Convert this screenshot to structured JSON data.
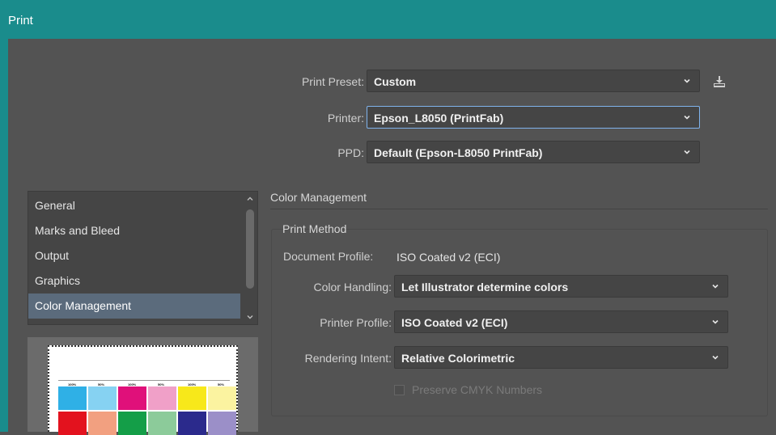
{
  "window": {
    "title": "Print"
  },
  "top": {
    "preset": {
      "label": "Print Preset:",
      "value": "Custom"
    },
    "printer": {
      "label": "Printer:",
      "value": "Epson_L8050 (PrintFab)"
    },
    "ppd": {
      "label": "PPD:",
      "value": "Default (Epson-L8050 PrintFab)"
    }
  },
  "sidebar": {
    "items": [
      {
        "label": "General"
      },
      {
        "label": "Marks and Bleed"
      },
      {
        "label": "Output"
      },
      {
        "label": "Graphics"
      },
      {
        "label": "Color Management"
      }
    ],
    "selected": "Color Management"
  },
  "preview": {
    "labels": [
      "100%",
      "50%",
      "100%",
      "50%",
      "100%",
      "50%"
    ],
    "row1_colors": [
      "#2fb0e6",
      "#86d2f2",
      "#e0107a",
      "#f0a0c8",
      "#f7e81a",
      "#fbf3a0"
    ],
    "row2_colors": [
      "#e3121e",
      "#f2a080",
      "#149e48",
      "#8ccb9a",
      "#2b2a8c",
      "#9b8fc8"
    ]
  },
  "color_management": {
    "title": "Color Management",
    "print_method": "Print Method",
    "document_profile": {
      "label": "Document Profile:",
      "value": "ISO Coated v2 (ECI)"
    },
    "color_handling": {
      "label": "Color Handling:",
      "value": "Let Illustrator determine colors"
    },
    "printer_profile": {
      "label": "Printer Profile:",
      "value": "ISO Coated v2 (ECI)"
    },
    "rendering_intent": {
      "label": "Rendering Intent:",
      "value": "Relative Colorimetric"
    },
    "preserve_cmyk": {
      "label": "Preserve CMYK Numbers",
      "checked": false,
      "enabled": false
    }
  },
  "colors": {
    "titlebar": "#1a8c8c",
    "background": "#535353",
    "selected": "#5b6b7c",
    "focus": "#7fb3ec"
  }
}
